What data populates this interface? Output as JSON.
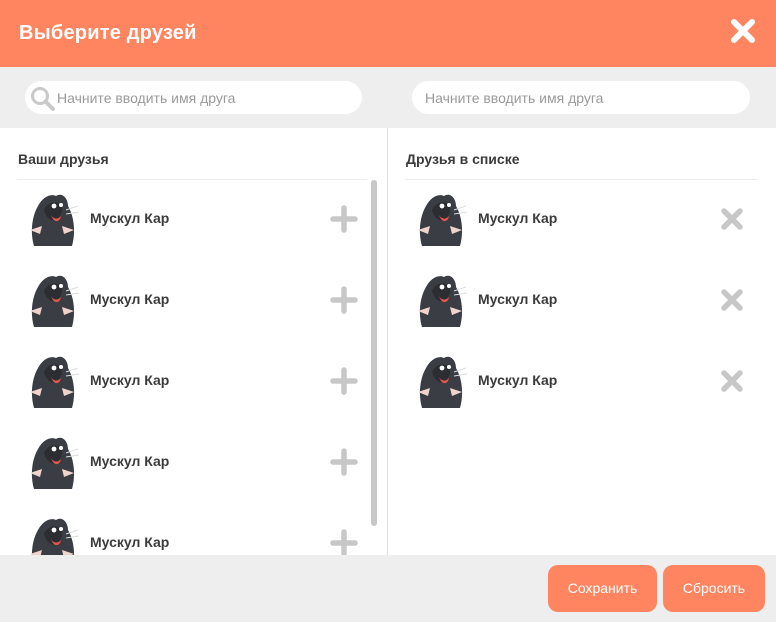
{
  "header": {
    "title": "Выберите друзей",
    "close_icon": "close-icon"
  },
  "search": {
    "left_placeholder": "Начните вводить имя друга",
    "right_placeholder": "Начните вводить имя друга"
  },
  "left_panel": {
    "title": "Ваши друзья",
    "friends": [
      {
        "name": "Мускул Кар",
        "action_icon": "plus-icon"
      },
      {
        "name": "Мускул Кар",
        "action_icon": "plus-icon"
      },
      {
        "name": "Мускул Кар",
        "action_icon": "plus-icon"
      },
      {
        "name": "Мускул Кар",
        "action_icon": "plus-icon"
      },
      {
        "name": "Мускул Кар",
        "action_icon": "plus-icon"
      }
    ]
  },
  "right_panel": {
    "title": "Друзья в списке",
    "friends": [
      {
        "name": "Мускул Кар",
        "action_icon": "remove-icon"
      },
      {
        "name": "Мускул Кар",
        "action_icon": "remove-icon"
      },
      {
        "name": "Мускул Кар",
        "action_icon": "remove-icon"
      }
    ]
  },
  "footer": {
    "save_label": "Сохранить",
    "reset_label": "Сбросить"
  },
  "colors": {
    "accent": "#ff8561",
    "toolbar": "#eeeeee",
    "text": "#3b3b3b",
    "icon_gray": "#c7c7c7"
  }
}
